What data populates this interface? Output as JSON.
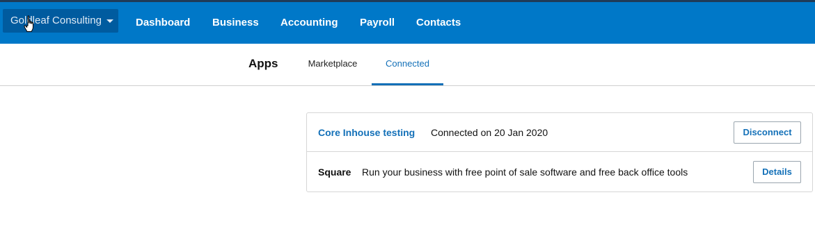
{
  "navbar": {
    "organisation": "Goldleaf Consulting",
    "items": [
      {
        "label": "Dashboard"
      },
      {
        "label": "Business"
      },
      {
        "label": "Accounting"
      },
      {
        "label": "Payroll"
      },
      {
        "label": "Contacts"
      }
    ]
  },
  "subnav": {
    "title": "Apps",
    "tabs": [
      {
        "label": "Marketplace",
        "active": false
      },
      {
        "label": "Connected",
        "active": true
      }
    ]
  },
  "apps": [
    {
      "name": "Core Inhouse testing",
      "status_text": "Connected on 20 Jan 2020",
      "action_label": "Disconnect"
    },
    {
      "name": "Square",
      "description": "Run your business with free point of sale software and free back office tools",
      "action_label": "Details"
    }
  ],
  "colors": {
    "navbar": "#0078c8",
    "org_button": "#005b9f",
    "link": "#1370b8"
  },
  "icons": {
    "org_caret": "caret-down-icon",
    "pointer": "hand-pointer-icon"
  }
}
